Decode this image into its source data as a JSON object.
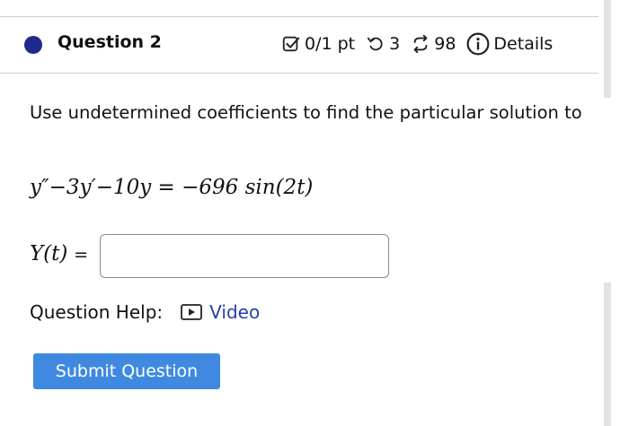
{
  "question": {
    "title": "Question 2",
    "status_color": "#1f2a8c",
    "score": "0/1 pt",
    "attempts": "3",
    "retries": "98",
    "details_label": "Details"
  },
  "body": {
    "prompt": "Use undetermined coefficients to find the particular solution to",
    "equation": "y″−3y′−10y = −696 sin(2t)",
    "answer_label": "Y(t)",
    "answer_equals": "=",
    "answer_value": "",
    "answer_placeholder": ""
  },
  "help": {
    "label": "Question Help:",
    "video_label": "Video",
    "video_icon": "video-play-icon"
  },
  "actions": {
    "submit_label": "Submit Question",
    "submit_color": "#3f8ae0",
    "link_color": "#2740a8"
  }
}
